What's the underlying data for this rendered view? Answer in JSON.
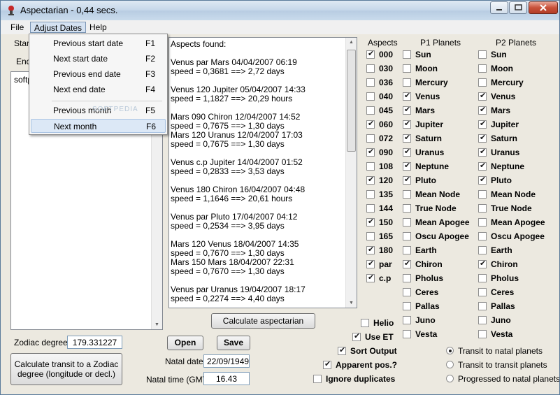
{
  "window": {
    "title": "Aspectarian - 0,44 secs."
  },
  "menu": {
    "items": [
      "File",
      "Adjust Dates",
      "Help"
    ]
  },
  "dropdown": {
    "items": [
      {
        "label": "Previous start date",
        "key": "F1"
      },
      {
        "label": "Next start date",
        "key": "F2"
      },
      {
        "label": "Previous end date",
        "key": "F3"
      },
      {
        "label": "Next end date",
        "key": "F4"
      },
      {
        "label": "Previous month",
        "key": "F5"
      },
      {
        "label": "Next month",
        "key": "F6"
      }
    ]
  },
  "left": {
    "start_label_partial": "Star",
    "end_label_partial": "End",
    "list_text": "softp"
  },
  "aspects_lines": [
    "Aspects found:",
    "",
    "Venus par Mars 04/04/2007 06:19",
    "    speed = 0,3681 ==> 2,72 days",
    "",
    "Venus 120 Jupiter 05/04/2007 14:33",
    "    speed = 1,1827 ==> 20,29 hours",
    "",
    "Mars 090 Chiron 12/04/2007 14:52",
    "    speed = 0,7675 ==> 1,30 days",
    "Mars 120 Uranus 12/04/2007 17:03",
    "    speed = 0,7675 ==> 1,30 days",
    "",
    "Venus c.p Jupiter 14/04/2007 01:52",
    "    speed = 0,2833 ==> 3,53 days",
    "",
    "Venus 180 Chiron 16/04/2007 04:48",
    "    speed = 1,1646 ==> 20,61 hours",
    "",
    "Venus par Pluto 17/04/2007 04:12",
    "    speed = 0,2534 ==> 3,95 days",
    "",
    "Mars 120 Venus 18/04/2007 14:35",
    "    speed = 0,7670 ==> 1,30 days",
    "Mars 150 Mars 18/04/2007 22:31",
    "    speed = 0,7670 ==> 1,30 days",
    "",
    "Venus par Uranus 19/04/2007 18:17",
    "    speed = 0,2274 ==> 4,40 days"
  ],
  "buttons": {
    "calculate_aspectarian": "Calculate aspectarian",
    "open": "Open",
    "save": "Save",
    "calc_transit": "Calculate transit to a Zodiac degree (longitude or decl.)"
  },
  "fields": {
    "zodiac_label": "Zodiac degree:",
    "zodiac_value": "179.331227",
    "natal_date_label": "Natal date:",
    "natal_date_value": "22/09/1949",
    "natal_time_label": "Natal time (GMT):",
    "natal_time_value": "16.43"
  },
  "headers": {
    "aspects": "Aspects",
    "p1": "P1 Planets",
    "p2": "P2 Planets"
  },
  "aspects": [
    {
      "label": "000",
      "checked": true
    },
    {
      "label": "030",
      "checked": false
    },
    {
      "label": "036",
      "checked": false
    },
    {
      "label": "040",
      "checked": false
    },
    {
      "label": "045",
      "checked": false
    },
    {
      "label": "060",
      "checked": true
    },
    {
      "label": "072",
      "checked": false
    },
    {
      "label": "090",
      "checked": true
    },
    {
      "label": "108",
      "checked": false
    },
    {
      "label": "120",
      "checked": true
    },
    {
      "label": "135",
      "checked": false
    },
    {
      "label": "144",
      "checked": false
    },
    {
      "label": "150",
      "checked": true
    },
    {
      "label": "165",
      "checked": false
    },
    {
      "label": "180",
      "checked": true
    },
    {
      "label": "par",
      "checked": true
    },
    {
      "label": "c.p",
      "checked": true
    }
  ],
  "p1_planets": [
    {
      "label": "Sun",
      "checked": false
    },
    {
      "label": "Moon",
      "checked": false
    },
    {
      "label": "Mercury",
      "checked": false
    },
    {
      "label": "Venus",
      "checked": true
    },
    {
      "label": "Mars",
      "checked": true
    },
    {
      "label": "Jupiter",
      "checked": true
    },
    {
      "label": "Saturn",
      "checked": true
    },
    {
      "label": "Uranus",
      "checked": true
    },
    {
      "label": "Neptune",
      "checked": true
    },
    {
      "label": "Pluto",
      "checked": true
    },
    {
      "label": "Mean Node",
      "checked": false
    },
    {
      "label": "True Node",
      "checked": false
    },
    {
      "label": "Mean Apogee",
      "checked": false
    },
    {
      "label": "Oscu Apogee",
      "checked": false
    },
    {
      "label": "Earth",
      "checked": false
    },
    {
      "label": "Chiron",
      "checked": true
    },
    {
      "label": "Pholus",
      "checked": false
    },
    {
      "label": "Ceres",
      "checked": false
    },
    {
      "label": "Pallas",
      "checked": false
    },
    {
      "label": "Juno",
      "checked": false
    },
    {
      "label": "Vesta",
      "checked": false
    }
  ],
  "p2_planets": [
    {
      "label": "Sun",
      "checked": false
    },
    {
      "label": "Moon",
      "checked": false
    },
    {
      "label": "Mercury",
      "checked": false
    },
    {
      "label": "Venus",
      "checked": true
    },
    {
      "label": "Mars",
      "checked": true
    },
    {
      "label": "Jupiter",
      "checked": true
    },
    {
      "label": "Saturn",
      "checked": true
    },
    {
      "label": "Uranus",
      "checked": true
    },
    {
      "label": "Neptune",
      "checked": true
    },
    {
      "label": "Pluto",
      "checked": true
    },
    {
      "label": "Mean Node",
      "checked": false
    },
    {
      "label": "True Node",
      "checked": false
    },
    {
      "label": "Mean Apogee",
      "checked": false
    },
    {
      "label": "Oscu Apogee",
      "checked": false
    },
    {
      "label": "Earth",
      "checked": false
    },
    {
      "label": "Chiron",
      "checked": true
    },
    {
      "label": "Pholus",
      "checked": false
    },
    {
      "label": "Ceres",
      "checked": false
    },
    {
      "label": "Pallas",
      "checked": false
    },
    {
      "label": "Juno",
      "checked": false
    },
    {
      "label": "Vesta",
      "checked": false
    }
  ],
  "options": {
    "helio": {
      "label": "Helio",
      "checked": false
    },
    "use_et": {
      "label": "Use ET",
      "checked": true
    },
    "sort_output": {
      "label": "Sort Output",
      "checked": true
    },
    "apparent_pos": {
      "label": "Apparent pos.?",
      "checked": true
    },
    "ignore_duplicates": {
      "label": "Ignore duplicates",
      "checked": false
    }
  },
  "modes": [
    {
      "label": "Transit to natal planets",
      "selected": true
    },
    {
      "label": "Transit to transit planets",
      "selected": false
    },
    {
      "label": "Progressed to natal planets",
      "selected": false
    }
  ],
  "watermark": "SOFTPEDIA"
}
